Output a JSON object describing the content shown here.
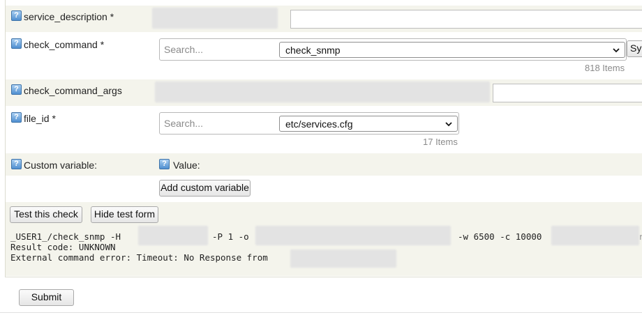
{
  "fields": {
    "service_description": {
      "help_icon": "question-icon",
      "label": "service_description *"
    },
    "check_command": {
      "label": "check_command *",
      "search_placeholder": "Search...",
      "selected": "check_snmp",
      "count": "818 Items",
      "side_button": "Sy"
    },
    "check_command_args": {
      "label": "check_command_args"
    },
    "file_id": {
      "label": "file_id *",
      "search_placeholder": "Search...",
      "selected": "etc/services.cfg",
      "count": "17 Items"
    },
    "custom_variable": {
      "label": "Custom variable:",
      "value_label": "Value:",
      "add_button": "Add custom variable"
    }
  },
  "test": {
    "test_button": "Test this check",
    "hide_button": "Hide test form",
    "output": {
      "line1_a": "_USER1_/check_snmp -H",
      "line1_b": "-P 1 -o",
      "line1_c": "-w 6500 -c 10000",
      "line1_d": "r",
      "line2": "Result code: UNKNOWN",
      "line3": "External command error: Timeout: No Response from"
    }
  },
  "submit_button": "Submit",
  "colors": {
    "row_alt": "#f4f4ec",
    "help_icon": "#4f8fd0",
    "muted_text": "#8a8a8a"
  }
}
